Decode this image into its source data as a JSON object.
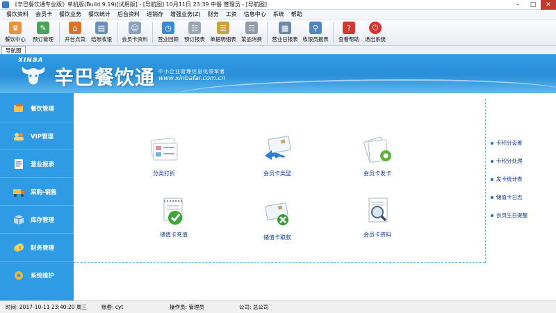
{
  "window": {
    "title": "《辛巴餐饮通专业版》单机版(Build 9.19)[试用版] - [导航图]   10月11日 23:39 中餐 管理员 - [导航图]"
  },
  "menu": [
    "餐饮资料",
    "会员卡",
    "餐饮业务",
    "餐饮统计",
    "后台资料",
    "进销存",
    "增强业务(Z)",
    "财务",
    "工资",
    "信息中心",
    "系统",
    "帮助"
  ],
  "toolbar": [
    {
      "label": "餐饮中心",
      "icon": "dining-center-icon",
      "color": "#e8923a"
    },
    {
      "label": "预订管理",
      "icon": "reservation-icon",
      "color": "#4aa35a"
    },
    {
      "label": "开台点菜",
      "icon": "open-table-icon",
      "color": "#d9742a"
    },
    {
      "label": "结账收银",
      "icon": "checkout-icon",
      "color": "#6a8fb8"
    },
    {
      "label": "会员卡资料",
      "icon": "member-card-icon",
      "color": "#8aa0bd"
    },
    {
      "label": "营业回顾",
      "icon": "business-review-icon",
      "color": "#3a8ad0"
    },
    {
      "label": "预订报表",
      "icon": "reservation-report-icon",
      "color": "#9aa7b6"
    },
    {
      "label": "单据明细表",
      "icon": "receipt-detail-icon",
      "color": "#c9a13d"
    },
    {
      "label": "菜品消费",
      "icon": "dish-consumption-icon",
      "color": "#8f9bab"
    },
    {
      "label": "营业日报表",
      "icon": "daily-report-icon",
      "color": "#6d87a8"
    },
    {
      "label": "收银员报表",
      "icon": "cashier-report-icon",
      "color": "#4f86c6"
    },
    {
      "label": "查看帮助",
      "icon": "help-icon",
      "color": "#d03a2e"
    },
    {
      "label": "退出系统",
      "icon": "exit-icon",
      "color": "#d63232"
    }
  ],
  "tab": {
    "label": "导航图"
  },
  "banner": {
    "brand_en": "XINBA",
    "brand": "辛巴餐饮通",
    "slogan": "中小企业管理信息化领军者",
    "url": "www.xinbafar.com.cn"
  },
  "sidebar": [
    {
      "label": "餐饮管理",
      "icon": "dining-management-icon"
    },
    {
      "label": "VIP管理",
      "icon": "vip-management-icon"
    },
    {
      "label": "营业报表",
      "icon": "business-report-icon"
    },
    {
      "label": "采购-销售",
      "icon": "purchase-sales-icon"
    },
    {
      "label": "库存管理",
      "icon": "inventory-icon"
    },
    {
      "label": "财务管理",
      "icon": "finance-icon"
    },
    {
      "label": "系统维护",
      "icon": "system-maintenance-icon"
    }
  ],
  "features": [
    {
      "label": "分类打折",
      "icon": "category-discount-icon"
    },
    {
      "label": "会员卡类型",
      "icon": "member-card-type-icon"
    },
    {
      "label": "会员卡发卡",
      "icon": "card-issue-icon"
    },
    {
      "label": "储值卡充值",
      "icon": "stored-card-recharge-icon"
    },
    {
      "label": "储值卡取款",
      "icon": "stored-card-withdraw-icon"
    },
    {
      "label": "会员卡资料",
      "icon": "member-card-info-icon"
    }
  ],
  "right_links": [
    "卡积分设置",
    "卡积分处理",
    "发卡统计表",
    "储值卡日志",
    "会员生日提醒"
  ],
  "status": {
    "time": "时间: 2017-10-11 23:40:20 周三",
    "account": "账套: cyt",
    "operator": "操作员: 管理员",
    "company": "公司: 总公司"
  },
  "colors": {
    "sidebar": "#2e9be4",
    "banner": "#2a8fd9",
    "link": "#123a8a"
  }
}
